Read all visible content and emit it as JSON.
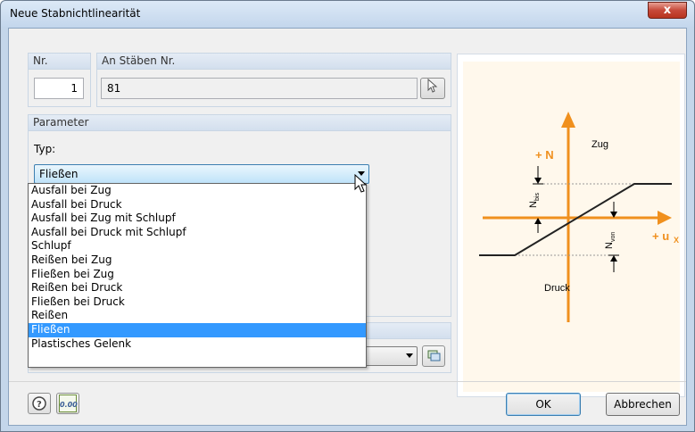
{
  "window": {
    "title": "Neue Stabnichtlinearität",
    "close_label": "x"
  },
  "nr": {
    "label": "Nr.",
    "value": "1"
  },
  "members": {
    "label": "An Stäben Nr.",
    "value": "81"
  },
  "parameter": {
    "header": "Parameter",
    "type_label": "Typ:",
    "selected": "Fließen",
    "options": [
      "Ausfall bei Zug",
      "Ausfall bei Druck",
      "Ausfall bei Zug mit Schlupf",
      "Ausfall bei Druck mit Schlupf",
      "Schlupf",
      "Reißen bei Zug",
      "Fließen bei Zug",
      "Reißen bei Druck",
      "Fließen bei Druck",
      "Reißen",
      "Fließen",
      "Plastisches Gelenk"
    ],
    "highlighted_index": 10
  },
  "diagram": {
    "n_label": "+ N",
    "u_label": "+ u",
    "u_subscript": "X",
    "zug": "Zug",
    "druck": "Druck",
    "n_bis": "N",
    "n_bis_sub": "bis",
    "n_von": "N",
    "n_von_sub": "von",
    "accent_color": "#f0901e"
  },
  "footer": {
    "ok_label": "OK",
    "cancel_label": "Abbrechen",
    "units_label": "0.00"
  }
}
